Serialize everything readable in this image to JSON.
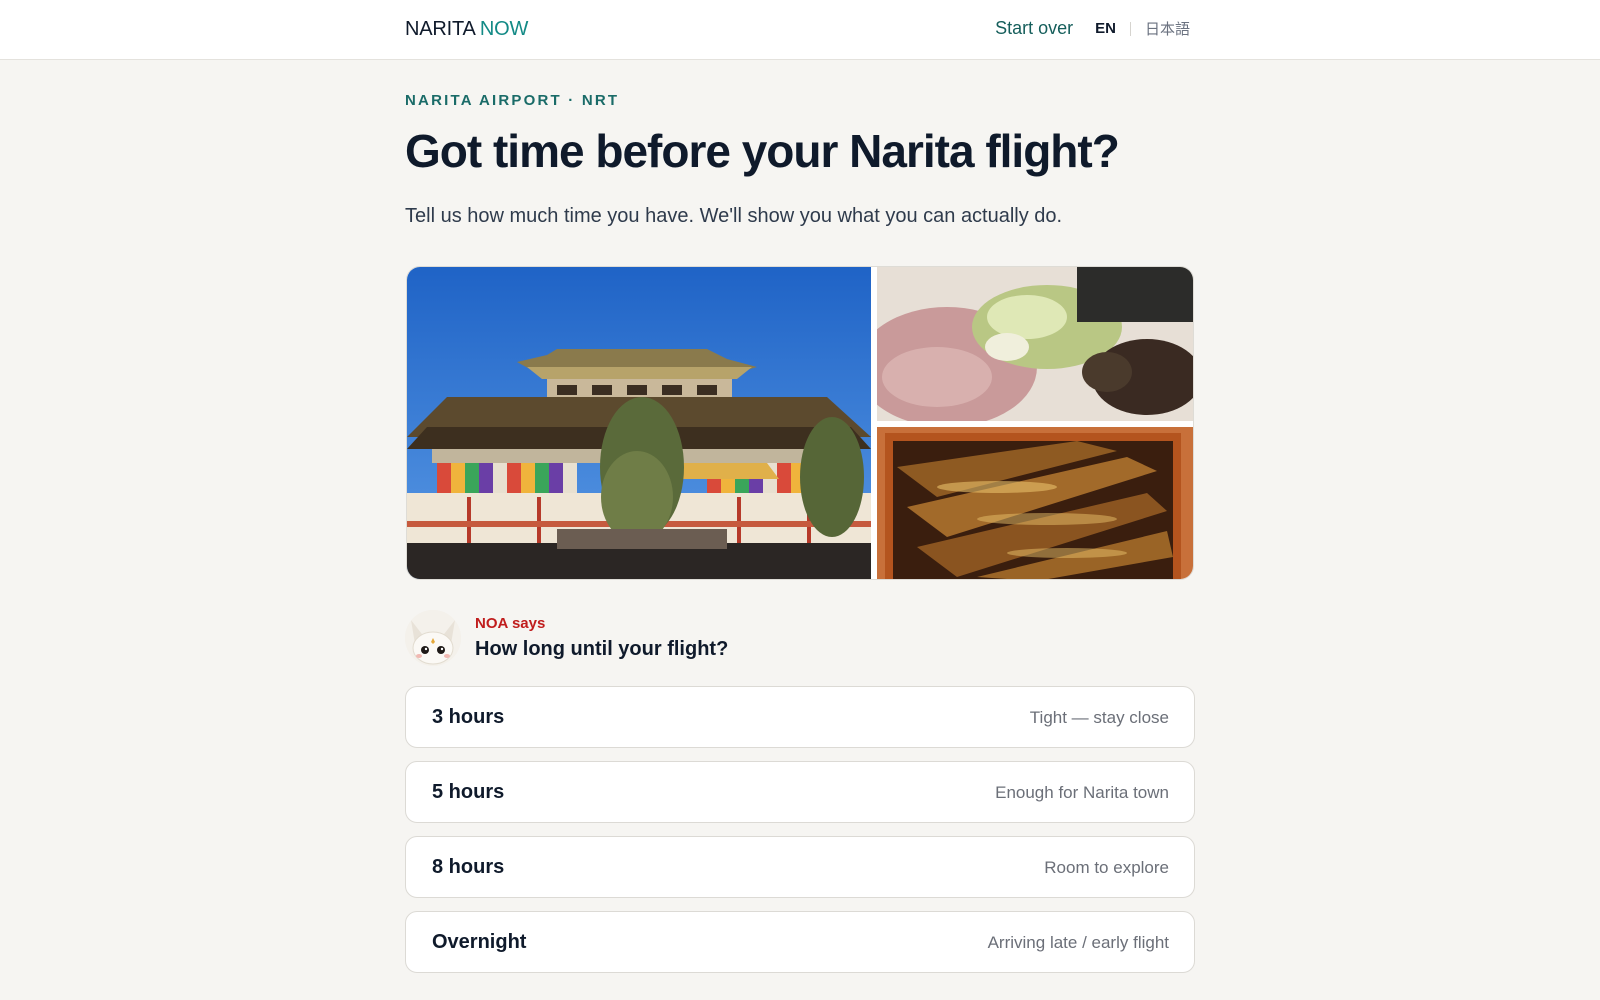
{
  "header": {
    "logo_part1": "NARITA",
    "logo_part2": "NOW",
    "start_over": "Start over",
    "lang_en": "EN",
    "lang_ja": "日本語"
  },
  "hero": {
    "eyebrow": "NARITA AIRPORT · NRT",
    "title": "Got time before your Narita flight?",
    "subtitle": "Tell us how much time you have. We'll show you what you can actually do."
  },
  "gallery": {
    "images": [
      {
        "subject": "temple-photo"
      },
      {
        "subject": "ramen-photo"
      },
      {
        "subject": "unagi-photo"
      }
    ]
  },
  "prompt": {
    "speaker": "NOA says",
    "question": "How long until your flight?"
  },
  "options": [
    {
      "label": "3 hours",
      "hint": "Tight — stay close"
    },
    {
      "label": "5 hours",
      "hint": "Enough for Narita town"
    },
    {
      "label": "8 hours",
      "hint": "Room to explore"
    },
    {
      "label": "Overnight",
      "hint": "Arriving late / early flight"
    }
  ],
  "colors": {
    "accent_teal": "#138a86",
    "speaker_red": "#c01d1d",
    "background": "#f6f5f2"
  }
}
